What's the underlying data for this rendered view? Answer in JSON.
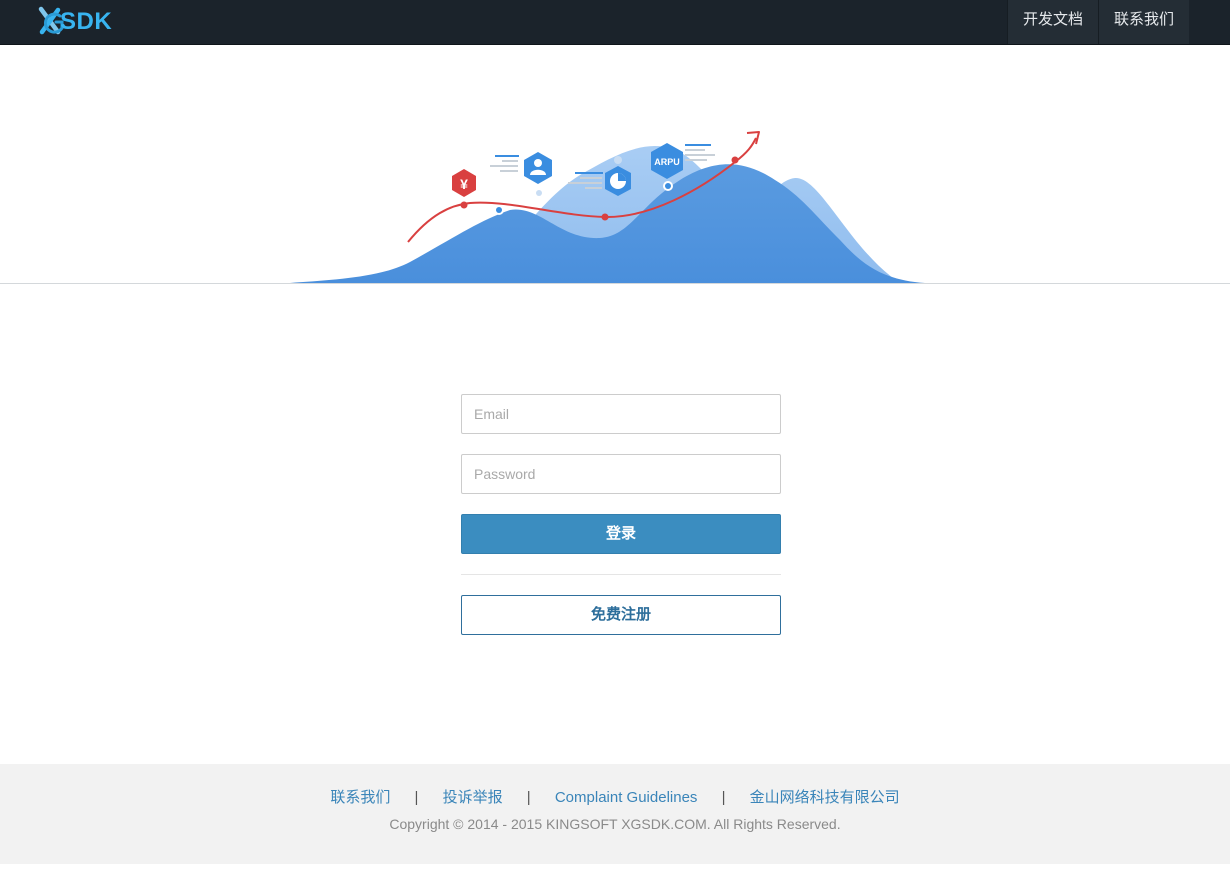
{
  "navbar": {
    "logo_text": "SDK",
    "links": [
      {
        "label": "开发文档"
      },
      {
        "label": "联系我们"
      }
    ]
  },
  "hero": {
    "yen_symbol": "¥",
    "arpu_label": "ARPU"
  },
  "login_form": {
    "email_placeholder": "Email",
    "email_value": "",
    "password_placeholder": "Password",
    "password_value": "",
    "login_label": "登录",
    "register_label": "免费注册"
  },
  "footer": {
    "links": [
      {
        "label": "联系我们"
      },
      {
        "label": "投诉举报"
      },
      {
        "label": "Complaint Guidelines"
      },
      {
        "label": "金山网络科技有限公司"
      }
    ],
    "separator": "|",
    "copyright": "Copyright © 2014 - 2015 KINGSOFT XGSDK.COM. All Rights Reserved."
  },
  "colors": {
    "navbar_bg": "#1b232b",
    "brand_blue": "#38b4f0",
    "login_button": "#3b8dc0",
    "link_blue": "#3a85b9",
    "accent_red": "#d94040"
  }
}
